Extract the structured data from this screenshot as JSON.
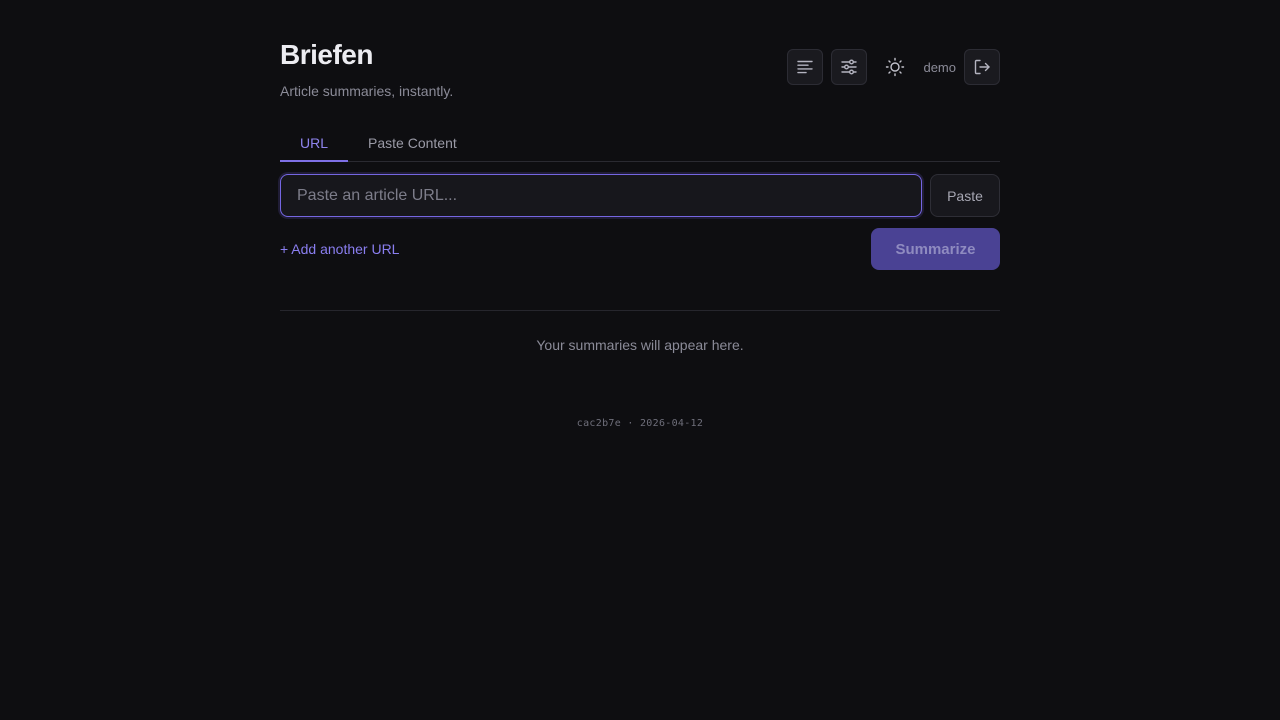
{
  "app": {
    "title": "Briefen",
    "subtitle": "Article summaries, instantly."
  },
  "header": {
    "icons": [
      "text-align-left-icon",
      "sliders-icon",
      "sun-icon",
      "logout-icon"
    ],
    "username": "demo"
  },
  "tabs": [
    {
      "label": "URL",
      "active": true
    },
    {
      "label": "Paste Content",
      "active": false
    }
  ],
  "form": {
    "url_placeholder": "Paste an article URL...",
    "url_value": "",
    "paste_label": "Paste",
    "add_url_label": "+ Add another URL",
    "summarize_label": "Summarize"
  },
  "results": {
    "empty_message": "Your summaries will appear here."
  },
  "footer": {
    "build_info": "cac2b7e · 2026-04-12"
  },
  "colors": {
    "background": "#0e0e11",
    "accent": "#7e70e6",
    "accent_button": "#4a4294",
    "muted_text": "#8b8b98"
  }
}
